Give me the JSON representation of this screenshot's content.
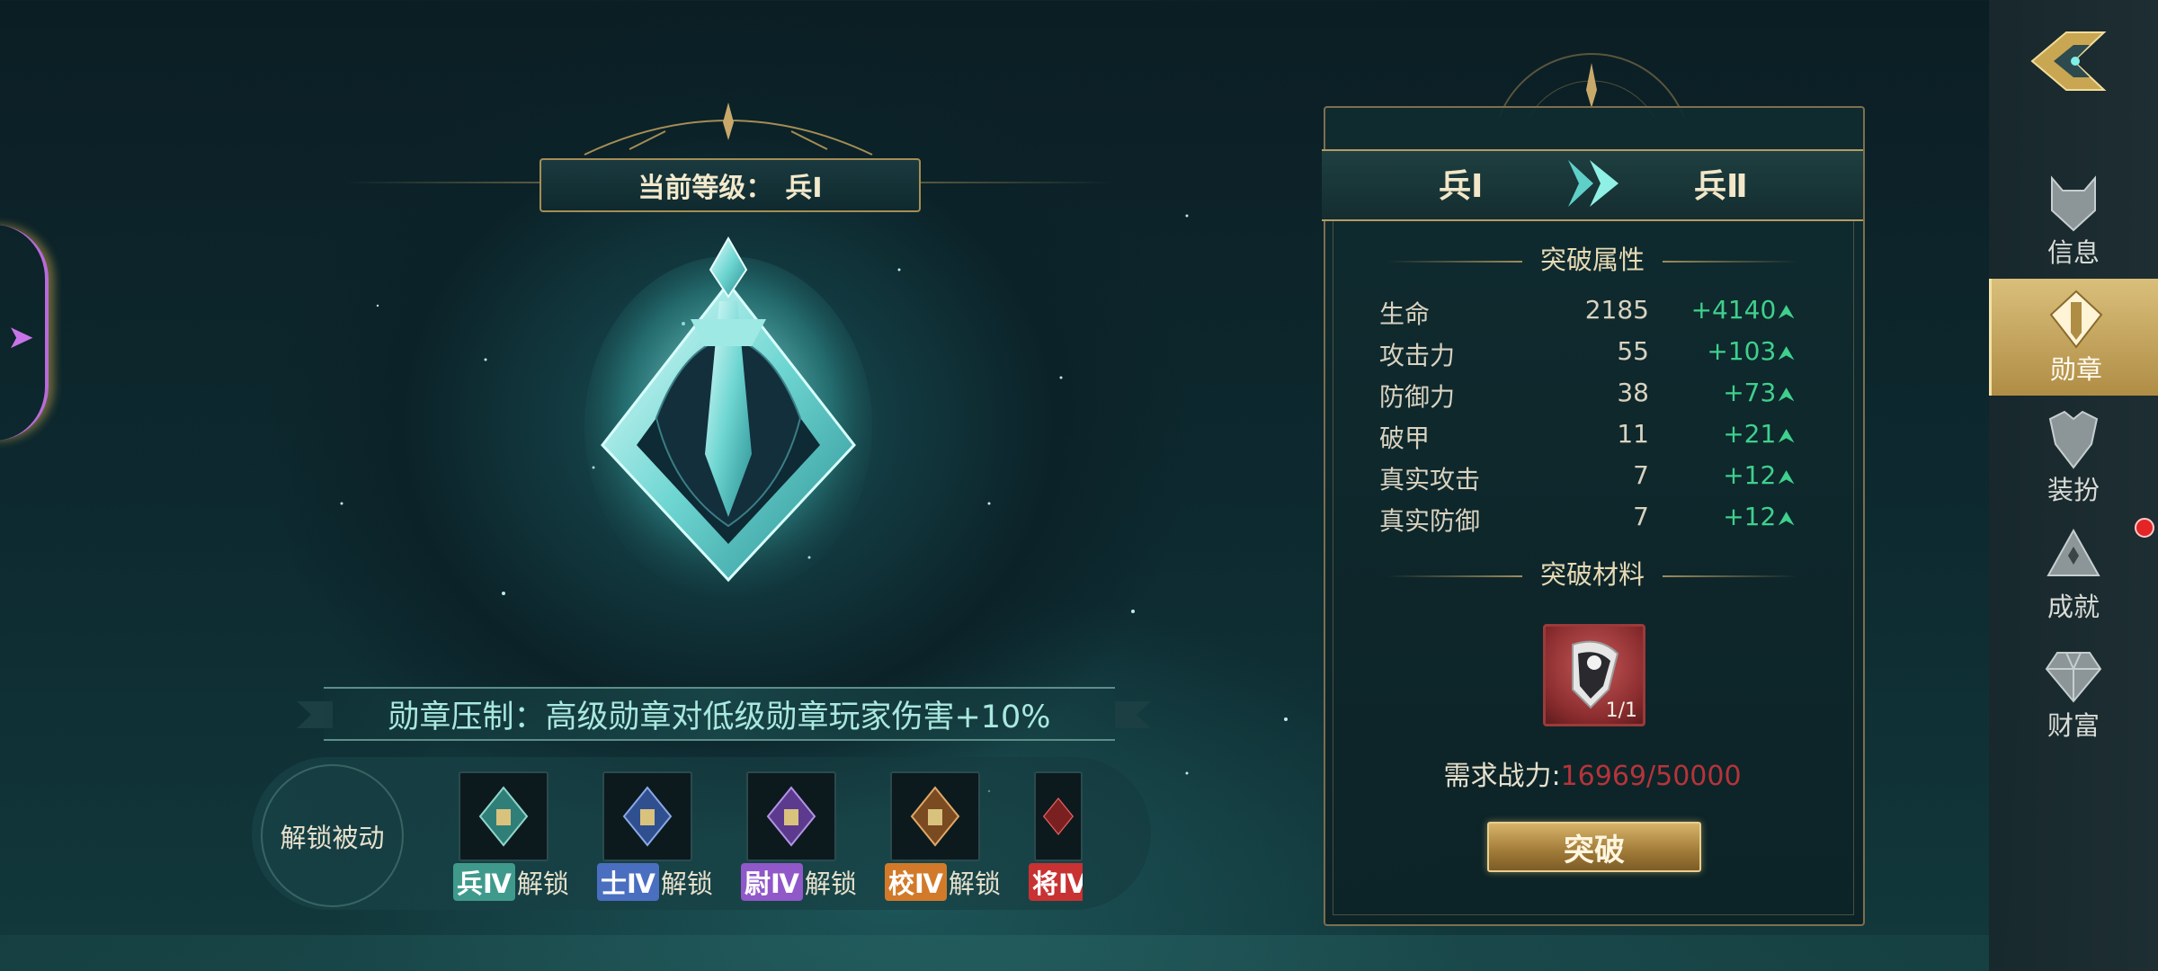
{
  "level": {
    "label": "当前等级：",
    "rank": "兵Ⅰ"
  },
  "suppression": {
    "text": "勋章压制：高级勋章对低级勋章玩家伤害+10%"
  },
  "passive": {
    "title": "解锁被动",
    "badges": [
      {
        "rank": "兵Ⅳ",
        "suffix": "解锁",
        "color": "#3f9a8c"
      },
      {
        "rank": "士Ⅳ",
        "suffix": "解锁",
        "color": "#4a6fc0"
      },
      {
        "rank": "尉Ⅳ",
        "suffix": "解锁",
        "color": "#9058c8"
      },
      {
        "rank": "校Ⅳ",
        "suffix": "解锁",
        "color": "#d27a2a"
      },
      {
        "rank": "将Ⅳ",
        "suffix": "",
        "color": "#c83232"
      }
    ]
  },
  "panel": {
    "rank_from": "兵Ⅰ",
    "rank_to": "兵Ⅱ",
    "attr_title": "突破属性",
    "attributes": [
      {
        "name": "生命",
        "value": "2185",
        "add": "+4140"
      },
      {
        "name": "攻击力",
        "value": "55",
        "add": "+103"
      },
      {
        "name": "防御力",
        "value": "38",
        "add": "+73"
      },
      {
        "name": "破甲",
        "value": "11",
        "add": "+21"
      },
      {
        "name": "真实攻击",
        "value": "7",
        "add": "+12"
      },
      {
        "name": "真实防御",
        "value": "7",
        "add": "+12"
      }
    ],
    "material_title": "突破材料",
    "material_count": "1/1",
    "power_label": "需求战力:",
    "power_value": "16969/50000",
    "button": "突破"
  },
  "sidebar": {
    "items": [
      {
        "label": "信息",
        "icon": "helmet-icon"
      },
      {
        "label": "勋章",
        "icon": "medal-icon"
      },
      {
        "label": "装扮",
        "icon": "armor-icon"
      },
      {
        "label": "成就",
        "icon": "trophy-icon"
      },
      {
        "label": "财富",
        "icon": "diamond-icon"
      }
    ]
  },
  "colors": {
    "accent_gold": "#b59c62",
    "stat_green": "#3fd08d",
    "power_red": "#b5343a"
  }
}
